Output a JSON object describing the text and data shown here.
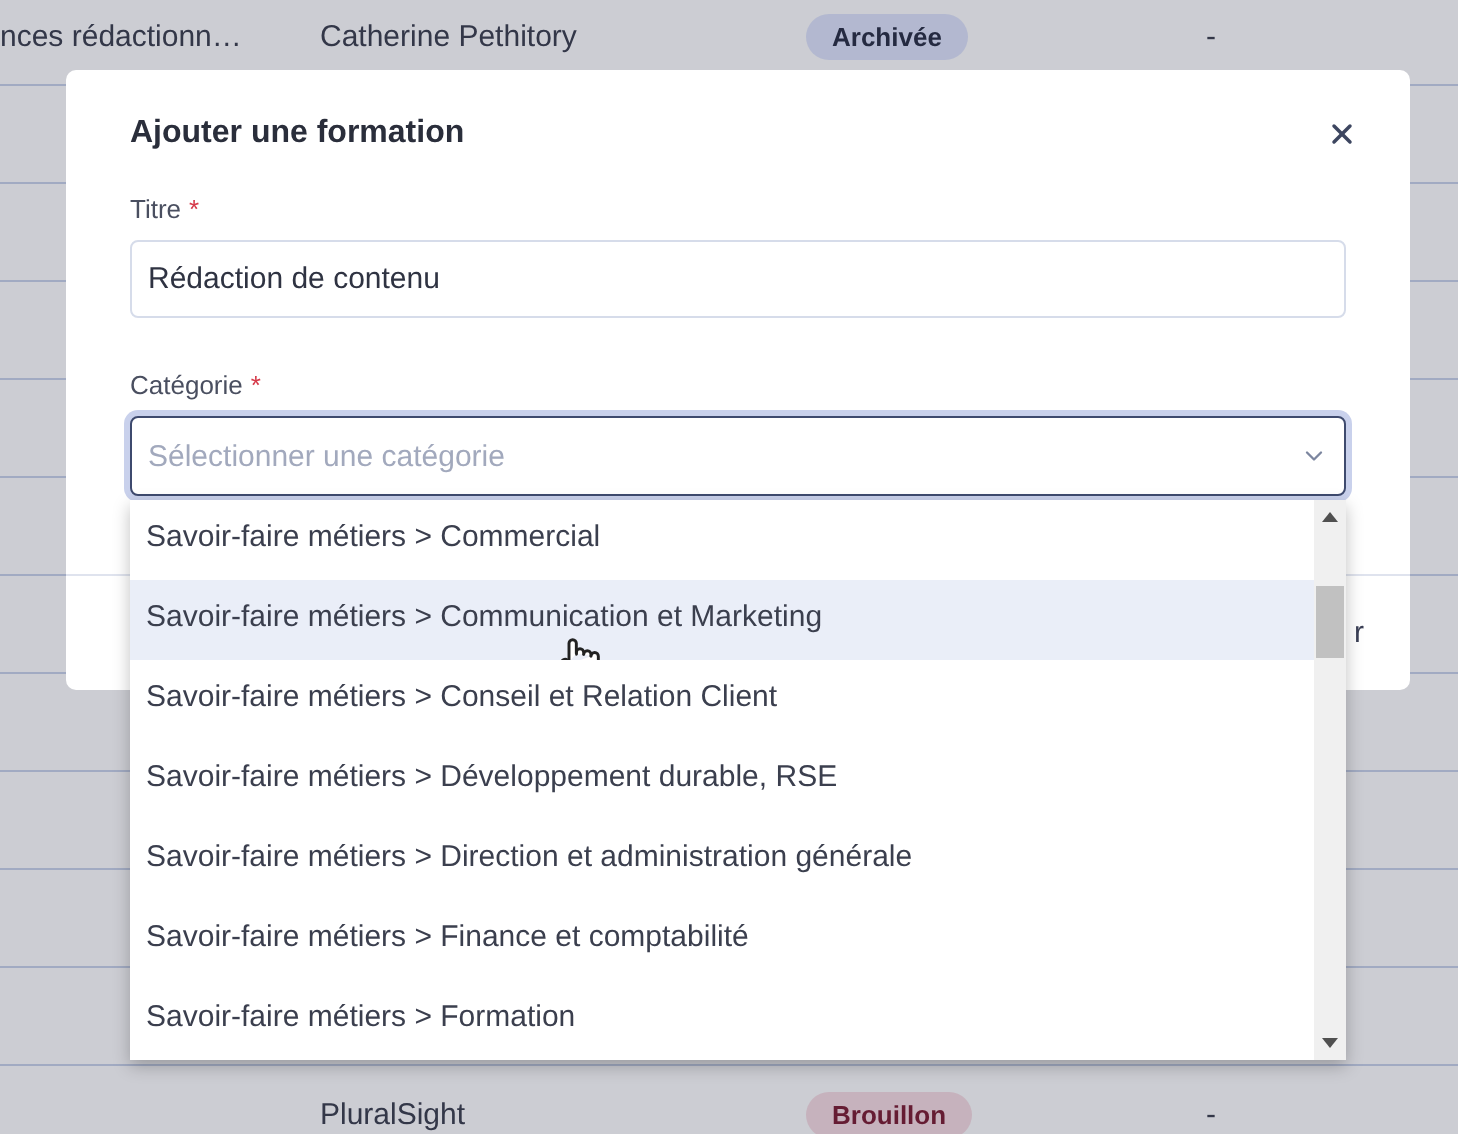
{
  "background_table": {
    "rows": [
      {
        "column_1": "nces rédactionn…",
        "column_2": "Catherine Pethitory",
        "status": {
          "label": "Archivée",
          "kind": "archived"
        },
        "column_4": "-"
      },
      {},
      {},
      {},
      {},
      {},
      {},
      {},
      {},
      {},
      {},
      {
        "column_2": "PluralSight",
        "status": {
          "label": "Brouillon",
          "kind": "draft"
        },
        "column_4": "-"
      }
    ]
  },
  "modal": {
    "title": "Ajouter une formation",
    "fields": [
      {
        "kind": "text",
        "label": "Titre",
        "required_mark": "*",
        "value": "Rédaction de contenu"
      },
      {
        "kind": "select",
        "label": "Catégorie",
        "required_mark": "*",
        "placeholder": "Sélectionner une catégorie",
        "expanded": true,
        "options": [
          {
            "label": "Savoir-faire métiers > Commercial",
            "highlighted": false
          },
          {
            "label": "Savoir-faire métiers > Communication et Marketing",
            "highlighted": true
          },
          {
            "label": "Savoir-faire métiers > Conseil et Relation Client",
            "highlighted": false
          },
          {
            "label": "Savoir-faire métiers > Développement durable, RSE",
            "highlighted": false
          },
          {
            "label": "Savoir-faire métiers > Direction et administration générale",
            "highlighted": false
          },
          {
            "label": "Savoir-faire métiers > Finance et comptabilité",
            "highlighted": false
          },
          {
            "label": "Savoir-faire métiers > Formation",
            "highlighted": false
          }
        ]
      }
    ],
    "footer": {
      "button_text": "r"
    }
  }
}
